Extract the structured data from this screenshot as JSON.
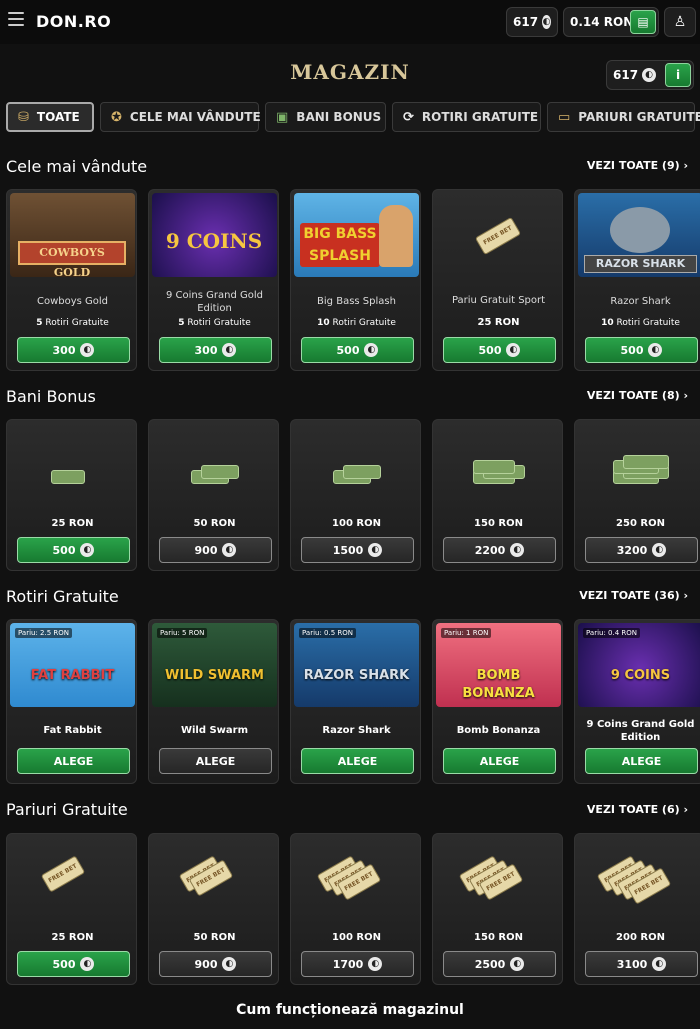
{
  "header": {
    "logo": "DON.RO",
    "points": "617",
    "balance": "0.14 RON"
  },
  "page_title": "MAGAZIN",
  "points_widget": "617",
  "tabs": [
    {
      "label": "TOATE",
      "icon": "basket-icon",
      "active": true
    },
    {
      "label": "CELE MAI VÂNDUTE",
      "icon": "medal-icon"
    },
    {
      "label": "BANI BONUS",
      "icon": "money-icon"
    },
    {
      "label": "ROTIRI GRATUITE",
      "icon": "refresh-icon"
    },
    {
      "label": "PARIURI GRATUITE",
      "icon": "ticket-icon"
    }
  ],
  "sections": {
    "best": {
      "title": "Cele mai vândute",
      "link": "VEZI TOATE (9)",
      "items": [
        {
          "name": "Cowboys Gold",
          "count": "5",
          "unit": "Rotiri Gratuite",
          "price": "300"
        },
        {
          "name": "9 Coins Grand Gold Edition",
          "count": "5",
          "unit": "Rotiri Gratuite",
          "price": "300"
        },
        {
          "name": "Big Bass Splash",
          "count": "10",
          "unit": "Rotiri Gratuite",
          "price": "500"
        },
        {
          "name": "Pariu Gratuit Sport",
          "count": "25 RON",
          "unit": "",
          "price": "500"
        },
        {
          "name": "Razor Shark",
          "count": "10",
          "unit": "Rotiri Gratuite",
          "price": "500"
        }
      ],
      "thumb_text": [
        "COWBOYS GOLD",
        "9 COINS",
        "BIG BASS SPLASH",
        "FREE BET",
        "RAZOR SHARK"
      ]
    },
    "bonus": {
      "title": "Bani Bonus",
      "link": "VEZI TOATE (8)",
      "items": [
        {
          "amount": "25 RON",
          "price": "500",
          "green": true
        },
        {
          "amount": "50 RON",
          "price": "900",
          "green": false
        },
        {
          "amount": "100 RON",
          "price": "1500",
          "green": false
        },
        {
          "amount": "150 RON",
          "price": "2200",
          "green": false
        },
        {
          "amount": "250 RON",
          "price": "3200",
          "green": false
        }
      ]
    },
    "spins": {
      "title": "Rotiri Gratuite",
      "link": "VEZI TOATE (36)",
      "button": "ALEGE",
      "items": [
        {
          "name": "Fat Rabbit",
          "bet": "Pariu: 2.5 RON",
          "thumb": "FAT RABBIT",
          "green": true
        },
        {
          "name": "Wild Swarm",
          "bet": "Pariu: 5 RON",
          "thumb": "WILD SWARM",
          "green": false
        },
        {
          "name": "Razor Shark",
          "bet": "Pariu: 0.5 RON",
          "thumb": "RAZOR SHARK",
          "green": true
        },
        {
          "name": "Bomb Bonanza",
          "bet": "Pariu: 1 RON",
          "thumb": "BOMB BONANZA",
          "green": true
        },
        {
          "name": "9 Coins Grand Gold Edition",
          "bet": "Pariu: 0.4 RON",
          "thumb": "9 COINS",
          "green": true
        }
      ]
    },
    "bets": {
      "title": "Pariuri Gratuite",
      "link": "VEZI TOATE (6)",
      "ticket": "FREE BET",
      "items": [
        {
          "amount": "25 RON",
          "price": "500",
          "green": true
        },
        {
          "amount": "50 RON",
          "price": "900",
          "green": false
        },
        {
          "amount": "100 RON",
          "price": "1700",
          "green": false
        },
        {
          "amount": "150 RON",
          "price": "2500",
          "green": false
        },
        {
          "amount": "200 RON",
          "price": "3100",
          "green": false
        }
      ]
    }
  },
  "footer": "Cum funcționează magazinul",
  "colors": {
    "green": "#1f8f3d",
    "title": "#d8c79a",
    "background": "#111111"
  }
}
